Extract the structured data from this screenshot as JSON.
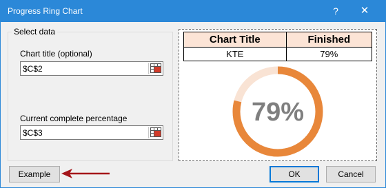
{
  "window": {
    "title": "Progress Ring Chart",
    "help_label": "?",
    "close_label": "✕"
  },
  "select_data": {
    "group_label": "Select data",
    "chart_title_label": "Chart title (optional)",
    "chart_title_value": "$C$2",
    "percentage_label": "Current complete percentage",
    "percentage_value": "$C$3"
  },
  "preview": {
    "headers": [
      "Chart Title",
      "Finished"
    ],
    "row": [
      "KTE",
      "79%"
    ],
    "ring_label": "79%",
    "ring_fraction": 0.79,
    "colors": {
      "ring_fill": "#e8873a",
      "ring_track": "#f9e3d4",
      "ring_text": "#7f7f7f",
      "header_bg": "#fce4d6"
    }
  },
  "buttons": {
    "example": "Example",
    "ok": "OK",
    "cancel": "Cancel"
  },
  "annotation": {
    "arrow_color": "#a5161a"
  }
}
